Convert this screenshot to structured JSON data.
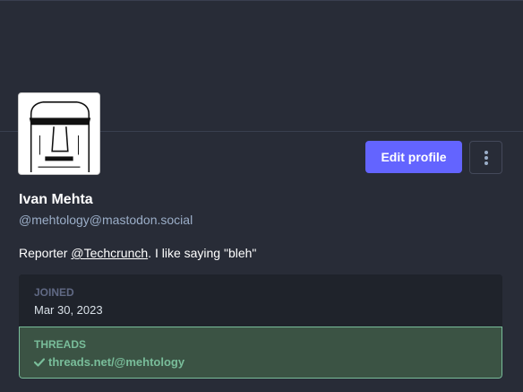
{
  "profile": {
    "display_name": "Ivan Mehta",
    "handle": "@mehtology@mastodon.social",
    "bio_prefix": "Reporter ",
    "bio_link": "@Techcrunch",
    "bio_suffix": ". I like saying \"bleh\"",
    "avatar_icon": "moai-avatar",
    "edit_button_label": "Edit profile",
    "more_icon": "vertical-ellipsis-icon",
    "fields": [
      {
        "name": "JOINED",
        "value": "Mar 30, 2023",
        "verified": false
      },
      {
        "name": "THREADS",
        "value": "threads.net/@mehtology",
        "verified": true
      }
    ]
  },
  "colors": {
    "background": "#282c37",
    "accent": "#6364ff",
    "verified_green": "#79bd9a",
    "handle_text": "#9baec8"
  }
}
